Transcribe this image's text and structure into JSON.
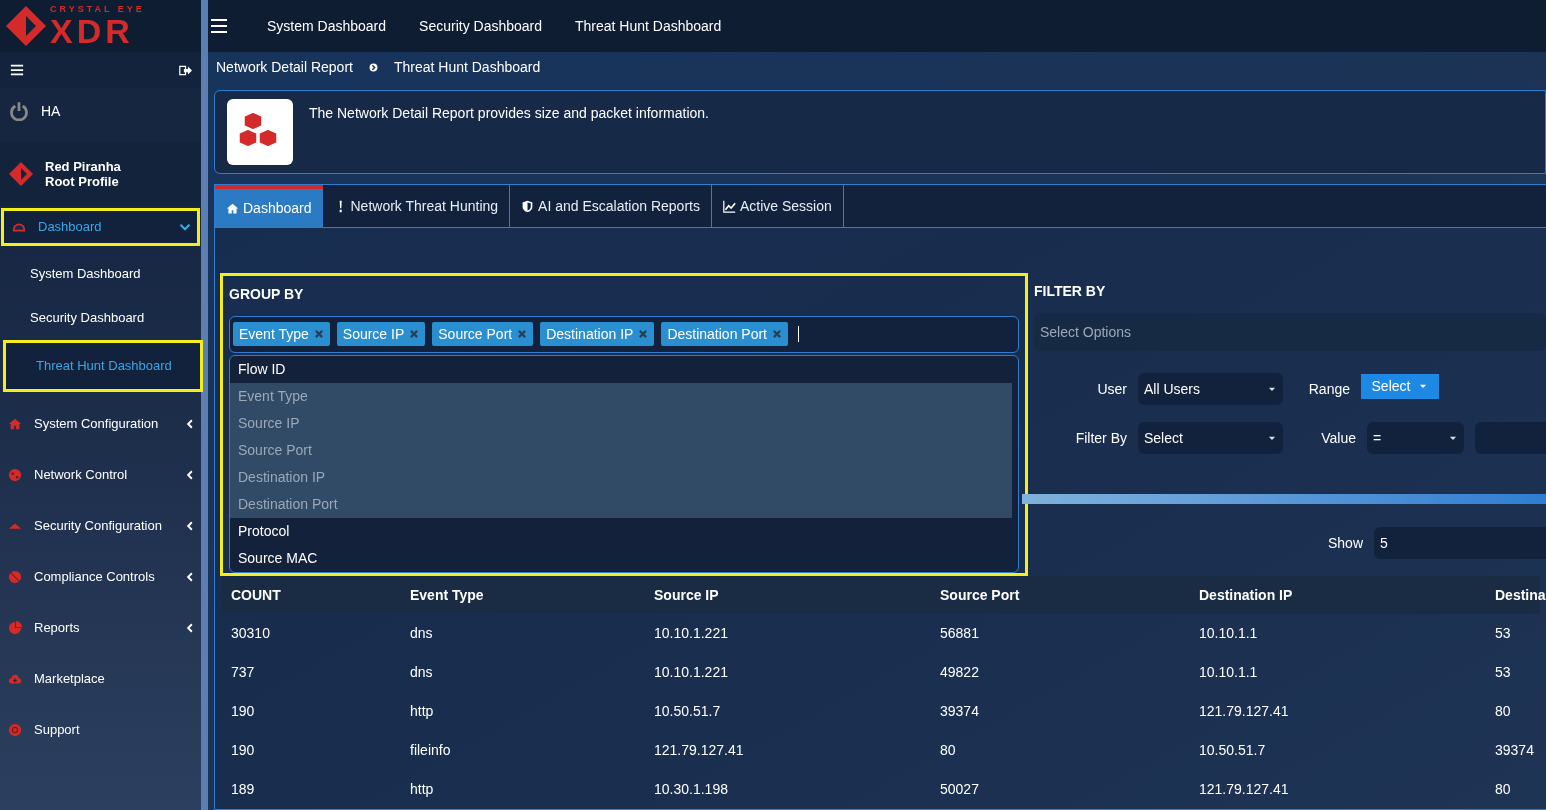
{
  "logo": {
    "line1": "CRYSTAL EYE",
    "line2": "XDR"
  },
  "topnav": [
    "System Dashboard",
    "Security Dashboard",
    "Threat Hunt Dashboard"
  ],
  "sidebar": {
    "ha": "HA",
    "profile": {
      "name": "Red Piranha",
      "role": "Root Profile"
    },
    "items": [
      {
        "label": "Dashboard",
        "selected": true,
        "expanded": true,
        "highlighted": true,
        "children": [
          {
            "label": "System Dashboard",
            "selected": false,
            "highlighted": false
          },
          {
            "label": "Security Dashboard",
            "selected": false,
            "highlighted": false
          },
          {
            "label": "Threat Hunt Dashboard",
            "selected": true,
            "highlighted": true
          }
        ]
      },
      {
        "label": "System Configuration",
        "selected": false,
        "expanded": false,
        "highlighted": false
      },
      {
        "label": "Network Control",
        "selected": false,
        "expanded": false,
        "highlighted": false
      },
      {
        "label": "Security Configuration",
        "selected": false,
        "expanded": false,
        "highlighted": false
      },
      {
        "label": "Compliance Controls",
        "selected": false,
        "expanded": false,
        "highlighted": false
      },
      {
        "label": "Reports",
        "selected": false,
        "expanded": false,
        "highlighted": false
      },
      {
        "label": "Marketplace",
        "selected": false,
        "highlighted": false
      },
      {
        "label": "Support",
        "selected": false,
        "highlighted": false
      }
    ]
  },
  "breadcrumb": [
    "Network Detail Report",
    "Threat Hunt Dashboard"
  ],
  "info": "The Network Detail Report provides size and packet information.",
  "tabs": [
    {
      "label": "Dashboard",
      "selected": true
    },
    {
      "label": "Network Threat Hunting",
      "selected": false
    },
    {
      "label": "AI and Escalation Reports",
      "selected": false
    },
    {
      "label": "Active Session",
      "selected": false
    }
  ],
  "group_by": {
    "title": "GROUP BY",
    "highlighted": true,
    "tags": [
      "Event Type",
      "Source IP",
      "Source Port",
      "Destination IP",
      "Destination Port"
    ],
    "options": [
      {
        "label": "Flow ID",
        "selected": false
      },
      {
        "label": "Event Type",
        "selected": true
      },
      {
        "label": "Source IP",
        "selected": true
      },
      {
        "label": "Source Port",
        "selected": true
      },
      {
        "label": "Destination IP",
        "selected": true
      },
      {
        "label": "Destination Port",
        "selected": true
      },
      {
        "label": "Protocol",
        "selected": false
      },
      {
        "label": "Source MAC",
        "selected": false
      }
    ]
  },
  "filter_by": {
    "title": "FILTER BY",
    "placeholder": "Select Options",
    "user_label": "User",
    "user_value": "All Users",
    "range_label": "Range",
    "range_button": "Select",
    "filter_label": "Filter By",
    "filter_value": "Select",
    "value_label": "Value",
    "operator": "="
  },
  "show": {
    "label": "Show",
    "value": "5"
  },
  "table": {
    "columns": [
      "COUNT",
      "Event Type",
      "Source IP",
      "Source Port",
      "Destination IP",
      "Destina"
    ],
    "rows": [
      [
        "30310",
        "dns",
        "10.10.1.221",
        "56881",
        "10.10.1.1",
        "53"
      ],
      [
        "737",
        "dns",
        "10.10.1.221",
        "49822",
        "10.10.1.1",
        "53"
      ],
      [
        "190",
        "http",
        "10.50.51.7",
        "39374",
        "121.79.127.41",
        "80"
      ],
      [
        "190",
        "fileinfo",
        "121.79.127.41",
        "80",
        "10.50.51.7",
        "39374"
      ],
      [
        "189",
        "http",
        "10.30.1.198",
        "50027",
        "121.79.127.41",
        "80"
      ]
    ]
  }
}
